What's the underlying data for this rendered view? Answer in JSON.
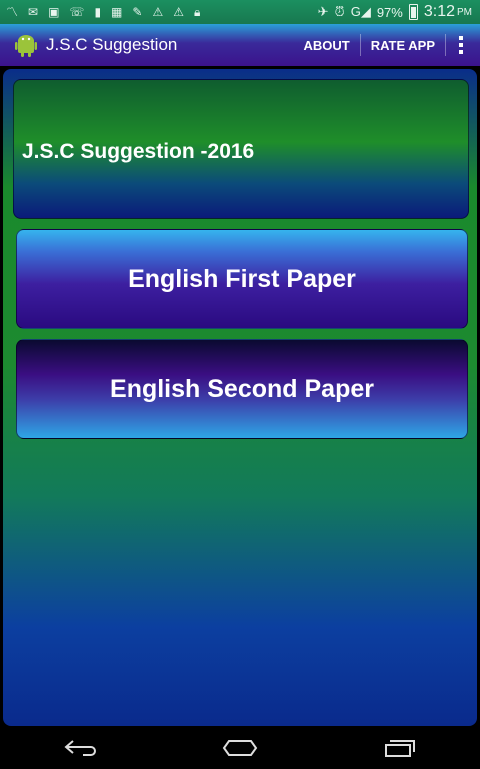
{
  "status_bar": {
    "notification_icons": [
      "signal-icon",
      "mail-icon",
      "image-icon",
      "phone-icon",
      "battery-charge-icon",
      "app-icon",
      "tag-icon",
      "warning-icon",
      "warning-icon",
      "lock-icon"
    ],
    "battery": "97%",
    "time": "3:12",
    "time_suffix": "PM"
  },
  "action_bar": {
    "title": "J.S.C Suggestion",
    "about": "ABOUT",
    "rate_app": "RATE APP"
  },
  "main": {
    "header": "J.S.C Suggestion -2016",
    "buttons": [
      {
        "label": "English First Paper"
      },
      {
        "label": "English Second Paper"
      }
    ]
  },
  "colors": {
    "status_bar": "#1b8a5c",
    "action_bar_top": "#2aa0d8",
    "action_bar_bottom": "#3b138c",
    "panel_green": "#1d8a30",
    "panel_blue": "#0a2a8c",
    "button_light": "#35b4ee",
    "button_dark": "#2a0a80"
  }
}
